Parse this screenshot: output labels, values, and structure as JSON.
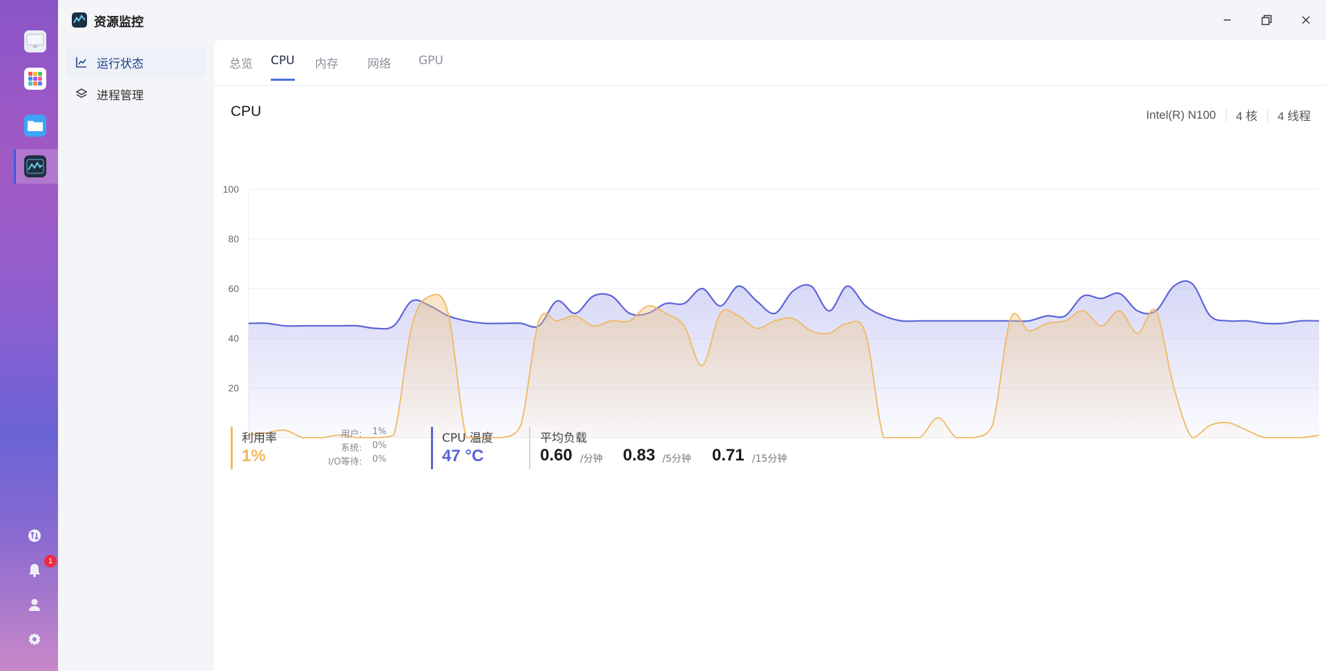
{
  "window": {
    "title": "资源监控",
    "minimize": "—",
    "maximize": "❐",
    "close": "✕"
  },
  "dock": {
    "notification_count": "1"
  },
  "sidebar": {
    "items": [
      {
        "label": "运行状态"
      },
      {
        "label": "进程管理"
      }
    ]
  },
  "tabs": [
    {
      "label": "总览"
    },
    {
      "label": "CPU"
    },
    {
      "label": "内存"
    },
    {
      "label": "网络"
    },
    {
      "label": "GPU"
    }
  ],
  "cpu": {
    "title": "CPU",
    "model": "Intel(R) N100",
    "cores": "4 核",
    "threads": "4 线程"
  },
  "stats": {
    "usage_label": "利用率",
    "usage_value": "1%",
    "user_label": "用户:",
    "user_value": "1%",
    "system_label": "系统:",
    "system_value": "0%",
    "io_label": "I/O等待:",
    "io_value": "0%",
    "temp_label": "CPU 温度",
    "temp_value": "47 °C",
    "load_label": "平均负载",
    "load_1": "0.60",
    "load_1_unit": "/分钟",
    "load_5": "0.83",
    "load_5_unit": "/5分钟",
    "load_15": "0.71",
    "load_15_unit": "/15分钟"
  },
  "colors": {
    "temperature": "#5b63d6",
    "usage": "#f0b860",
    "accent": "#4a6fe0"
  },
  "chart_data": {
    "type": "area",
    "ylim": [
      0,
      100
    ],
    "yticks": [
      "100",
      "80",
      "60",
      "40",
      "20"
    ],
    "series": [
      {
        "values": [
          46,
          46,
          45,
          45,
          45,
          45,
          45,
          44,
          45,
          55,
          53,
          49,
          47,
          46,
          46,
          46,
          45,
          55,
          50,
          57,
          57,
          50,
          50,
          54,
          54,
          60,
          53,
          61,
          55,
          50,
          59,
          61,
          51,
          61,
          53,
          49,
          47,
          47,
          47,
          47,
          47,
          47,
          47,
          47,
          49,
          49,
          57,
          56,
          58,
          51,
          51,
          61,
          62,
          49,
          47,
          47,
          46,
          46,
          47,
          47
        ]
      },
      {
        "values": [
          1,
          2,
          3,
          0,
          0,
          1,
          0,
          0,
          1,
          45,
          57,
          50,
          0,
          0,
          0,
          5,
          47,
          47,
          49,
          45,
          47,
          47,
          53,
          50,
          45,
          29,
          50,
          49,
          44,
          47,
          48,
          43,
          42,
          46,
          42,
          0,
          0,
          0,
          8,
          0,
          0,
          5,
          48,
          43,
          46,
          47,
          51,
          45,
          51,
          42,
          51,
          20,
          0,
          5,
          6,
          3,
          0,
          0,
          0,
          1
        ]
      }
    ]
  }
}
